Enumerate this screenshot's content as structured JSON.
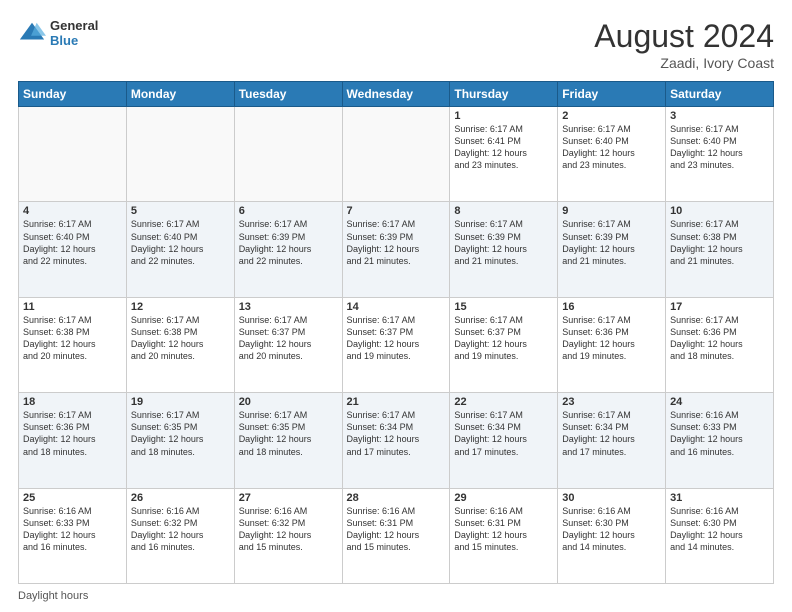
{
  "logo": {
    "text_general": "General",
    "text_blue": "Blue"
  },
  "title": {
    "month_year": "August 2024",
    "location": "Zaadi, Ivory Coast"
  },
  "days_header": [
    "Sunday",
    "Monday",
    "Tuesday",
    "Wednesday",
    "Thursday",
    "Friday",
    "Saturday"
  ],
  "footer": {
    "label": "Daylight hours"
  },
  "weeks": [
    [
      {
        "day": "",
        "info": ""
      },
      {
        "day": "",
        "info": ""
      },
      {
        "day": "",
        "info": ""
      },
      {
        "day": "",
        "info": ""
      },
      {
        "day": "1",
        "info": "Sunrise: 6:17 AM\nSunset: 6:41 PM\nDaylight: 12 hours\nand 23 minutes."
      },
      {
        "day": "2",
        "info": "Sunrise: 6:17 AM\nSunset: 6:40 PM\nDaylight: 12 hours\nand 23 minutes."
      },
      {
        "day": "3",
        "info": "Sunrise: 6:17 AM\nSunset: 6:40 PM\nDaylight: 12 hours\nand 23 minutes."
      }
    ],
    [
      {
        "day": "4",
        "info": "Sunrise: 6:17 AM\nSunset: 6:40 PM\nDaylight: 12 hours\nand 22 minutes."
      },
      {
        "day": "5",
        "info": "Sunrise: 6:17 AM\nSunset: 6:40 PM\nDaylight: 12 hours\nand 22 minutes."
      },
      {
        "day": "6",
        "info": "Sunrise: 6:17 AM\nSunset: 6:39 PM\nDaylight: 12 hours\nand 22 minutes."
      },
      {
        "day": "7",
        "info": "Sunrise: 6:17 AM\nSunset: 6:39 PM\nDaylight: 12 hours\nand 21 minutes."
      },
      {
        "day": "8",
        "info": "Sunrise: 6:17 AM\nSunset: 6:39 PM\nDaylight: 12 hours\nand 21 minutes."
      },
      {
        "day": "9",
        "info": "Sunrise: 6:17 AM\nSunset: 6:39 PM\nDaylight: 12 hours\nand 21 minutes."
      },
      {
        "day": "10",
        "info": "Sunrise: 6:17 AM\nSunset: 6:38 PM\nDaylight: 12 hours\nand 21 minutes."
      }
    ],
    [
      {
        "day": "11",
        "info": "Sunrise: 6:17 AM\nSunset: 6:38 PM\nDaylight: 12 hours\nand 20 minutes."
      },
      {
        "day": "12",
        "info": "Sunrise: 6:17 AM\nSunset: 6:38 PM\nDaylight: 12 hours\nand 20 minutes."
      },
      {
        "day": "13",
        "info": "Sunrise: 6:17 AM\nSunset: 6:37 PM\nDaylight: 12 hours\nand 20 minutes."
      },
      {
        "day": "14",
        "info": "Sunrise: 6:17 AM\nSunset: 6:37 PM\nDaylight: 12 hours\nand 19 minutes."
      },
      {
        "day": "15",
        "info": "Sunrise: 6:17 AM\nSunset: 6:37 PM\nDaylight: 12 hours\nand 19 minutes."
      },
      {
        "day": "16",
        "info": "Sunrise: 6:17 AM\nSunset: 6:36 PM\nDaylight: 12 hours\nand 19 minutes."
      },
      {
        "day": "17",
        "info": "Sunrise: 6:17 AM\nSunset: 6:36 PM\nDaylight: 12 hours\nand 18 minutes."
      }
    ],
    [
      {
        "day": "18",
        "info": "Sunrise: 6:17 AM\nSunset: 6:36 PM\nDaylight: 12 hours\nand 18 minutes."
      },
      {
        "day": "19",
        "info": "Sunrise: 6:17 AM\nSunset: 6:35 PM\nDaylight: 12 hours\nand 18 minutes."
      },
      {
        "day": "20",
        "info": "Sunrise: 6:17 AM\nSunset: 6:35 PM\nDaylight: 12 hours\nand 18 minutes."
      },
      {
        "day": "21",
        "info": "Sunrise: 6:17 AM\nSunset: 6:34 PM\nDaylight: 12 hours\nand 17 minutes."
      },
      {
        "day": "22",
        "info": "Sunrise: 6:17 AM\nSunset: 6:34 PM\nDaylight: 12 hours\nand 17 minutes."
      },
      {
        "day": "23",
        "info": "Sunrise: 6:17 AM\nSunset: 6:34 PM\nDaylight: 12 hours\nand 17 minutes."
      },
      {
        "day": "24",
        "info": "Sunrise: 6:16 AM\nSunset: 6:33 PM\nDaylight: 12 hours\nand 16 minutes."
      }
    ],
    [
      {
        "day": "25",
        "info": "Sunrise: 6:16 AM\nSunset: 6:33 PM\nDaylight: 12 hours\nand 16 minutes."
      },
      {
        "day": "26",
        "info": "Sunrise: 6:16 AM\nSunset: 6:32 PM\nDaylight: 12 hours\nand 16 minutes."
      },
      {
        "day": "27",
        "info": "Sunrise: 6:16 AM\nSunset: 6:32 PM\nDaylight: 12 hours\nand 15 minutes."
      },
      {
        "day": "28",
        "info": "Sunrise: 6:16 AM\nSunset: 6:31 PM\nDaylight: 12 hours\nand 15 minutes."
      },
      {
        "day": "29",
        "info": "Sunrise: 6:16 AM\nSunset: 6:31 PM\nDaylight: 12 hours\nand 15 minutes."
      },
      {
        "day": "30",
        "info": "Sunrise: 6:16 AM\nSunset: 6:30 PM\nDaylight: 12 hours\nand 14 minutes."
      },
      {
        "day": "31",
        "info": "Sunrise: 6:16 AM\nSunset: 6:30 PM\nDaylight: 12 hours\nand 14 minutes."
      }
    ]
  ]
}
